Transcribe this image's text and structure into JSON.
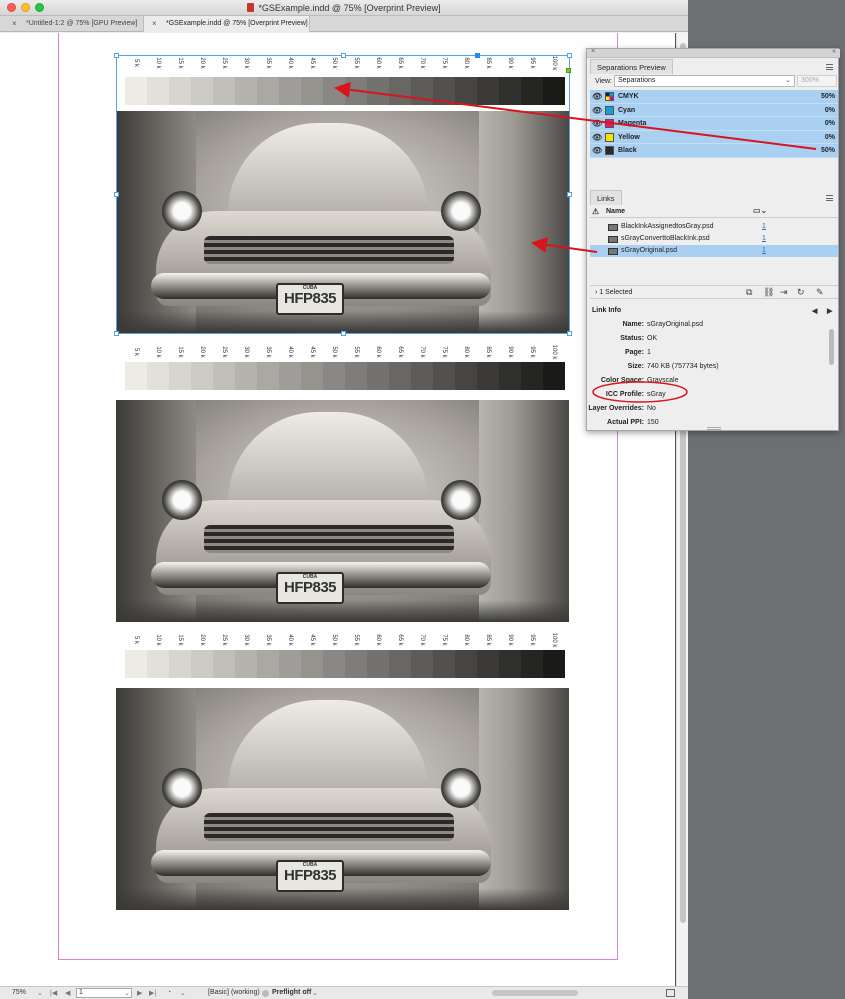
{
  "window": {
    "title": "*GSExample.indd @ 75% [Overprint Preview]",
    "tabs": [
      {
        "close": "×",
        "label": "*Untitled-1:2 @ 75% [GPU Preview]"
      },
      {
        "close": "×",
        "label": "*GSExample.indd @ 75% [Overprint Preview]"
      }
    ]
  },
  "ramp_labels": [
    "5 k",
    "10 k",
    "15 k",
    "20 k",
    "25 k",
    "30 k",
    "35 k",
    "40 k",
    "45 k",
    "50 k",
    "55 k",
    "60 k",
    "65 k",
    "70 k",
    "75 k",
    "80 k",
    "85 k",
    "90 k",
    "95 k",
    "100 k"
  ],
  "ramp_levels": [
    5,
    10,
    15,
    20,
    25,
    30,
    35,
    40,
    45,
    50,
    55,
    60,
    65,
    70,
    75,
    80,
    85,
    90,
    95,
    100
  ],
  "photo": {
    "plate_country": "CUBA",
    "plate_number": "HFP835"
  },
  "separations_panel": {
    "tab": "Separations Preview",
    "view_label": "View:",
    "view_value": "Separations",
    "zoom_value": "300%",
    "inks": [
      {
        "name": "CMYK",
        "percent": "50%",
        "color": "multi"
      },
      {
        "name": "Cyan",
        "percent": "0%",
        "color": "#1b9ad6"
      },
      {
        "name": "Magenta",
        "percent": "0%",
        "color": "#e0186e"
      },
      {
        "name": "Yellow",
        "percent": "0%",
        "color": "#f5e400"
      },
      {
        "name": "Black",
        "percent": "50%",
        "color": "#2a2a2a"
      }
    ]
  },
  "links_panel": {
    "tab": "Links",
    "header_name": "Name",
    "rows": [
      {
        "name": "BlackInkAssignedtosGray.psd",
        "page": "1"
      },
      {
        "name": "sGrayConverttoBlackInk.psd",
        "page": "1"
      },
      {
        "name": "sGrayOriginal.psd",
        "page": "1"
      }
    ],
    "selected_count": "1 Selected",
    "link_info_title": "Link Info",
    "info": [
      {
        "key": "Name:",
        "value": "sGrayOriginal.psd"
      },
      {
        "key": "Status:",
        "value": "OK"
      },
      {
        "key": "Page:",
        "value": "1"
      },
      {
        "key": "Size:",
        "value": "740 KB (757734 bytes)"
      },
      {
        "key": "Color Space:",
        "value": "Grayscale"
      },
      {
        "key": "ICC Profile:",
        "value": "sGray"
      },
      {
        "key": "Layer Overrides:",
        "value": "No"
      },
      {
        "key": "Actual PPI:",
        "value": "150"
      }
    ]
  },
  "statusbar": {
    "zoom": "75%",
    "page": "1",
    "profile": "[Basic] (working)",
    "preflight": "Preflight off"
  },
  "colors": {
    "annotation_red": "#d8141c",
    "selection_blue": "#53a5e8",
    "margin_guide": "#d483d6"
  }
}
